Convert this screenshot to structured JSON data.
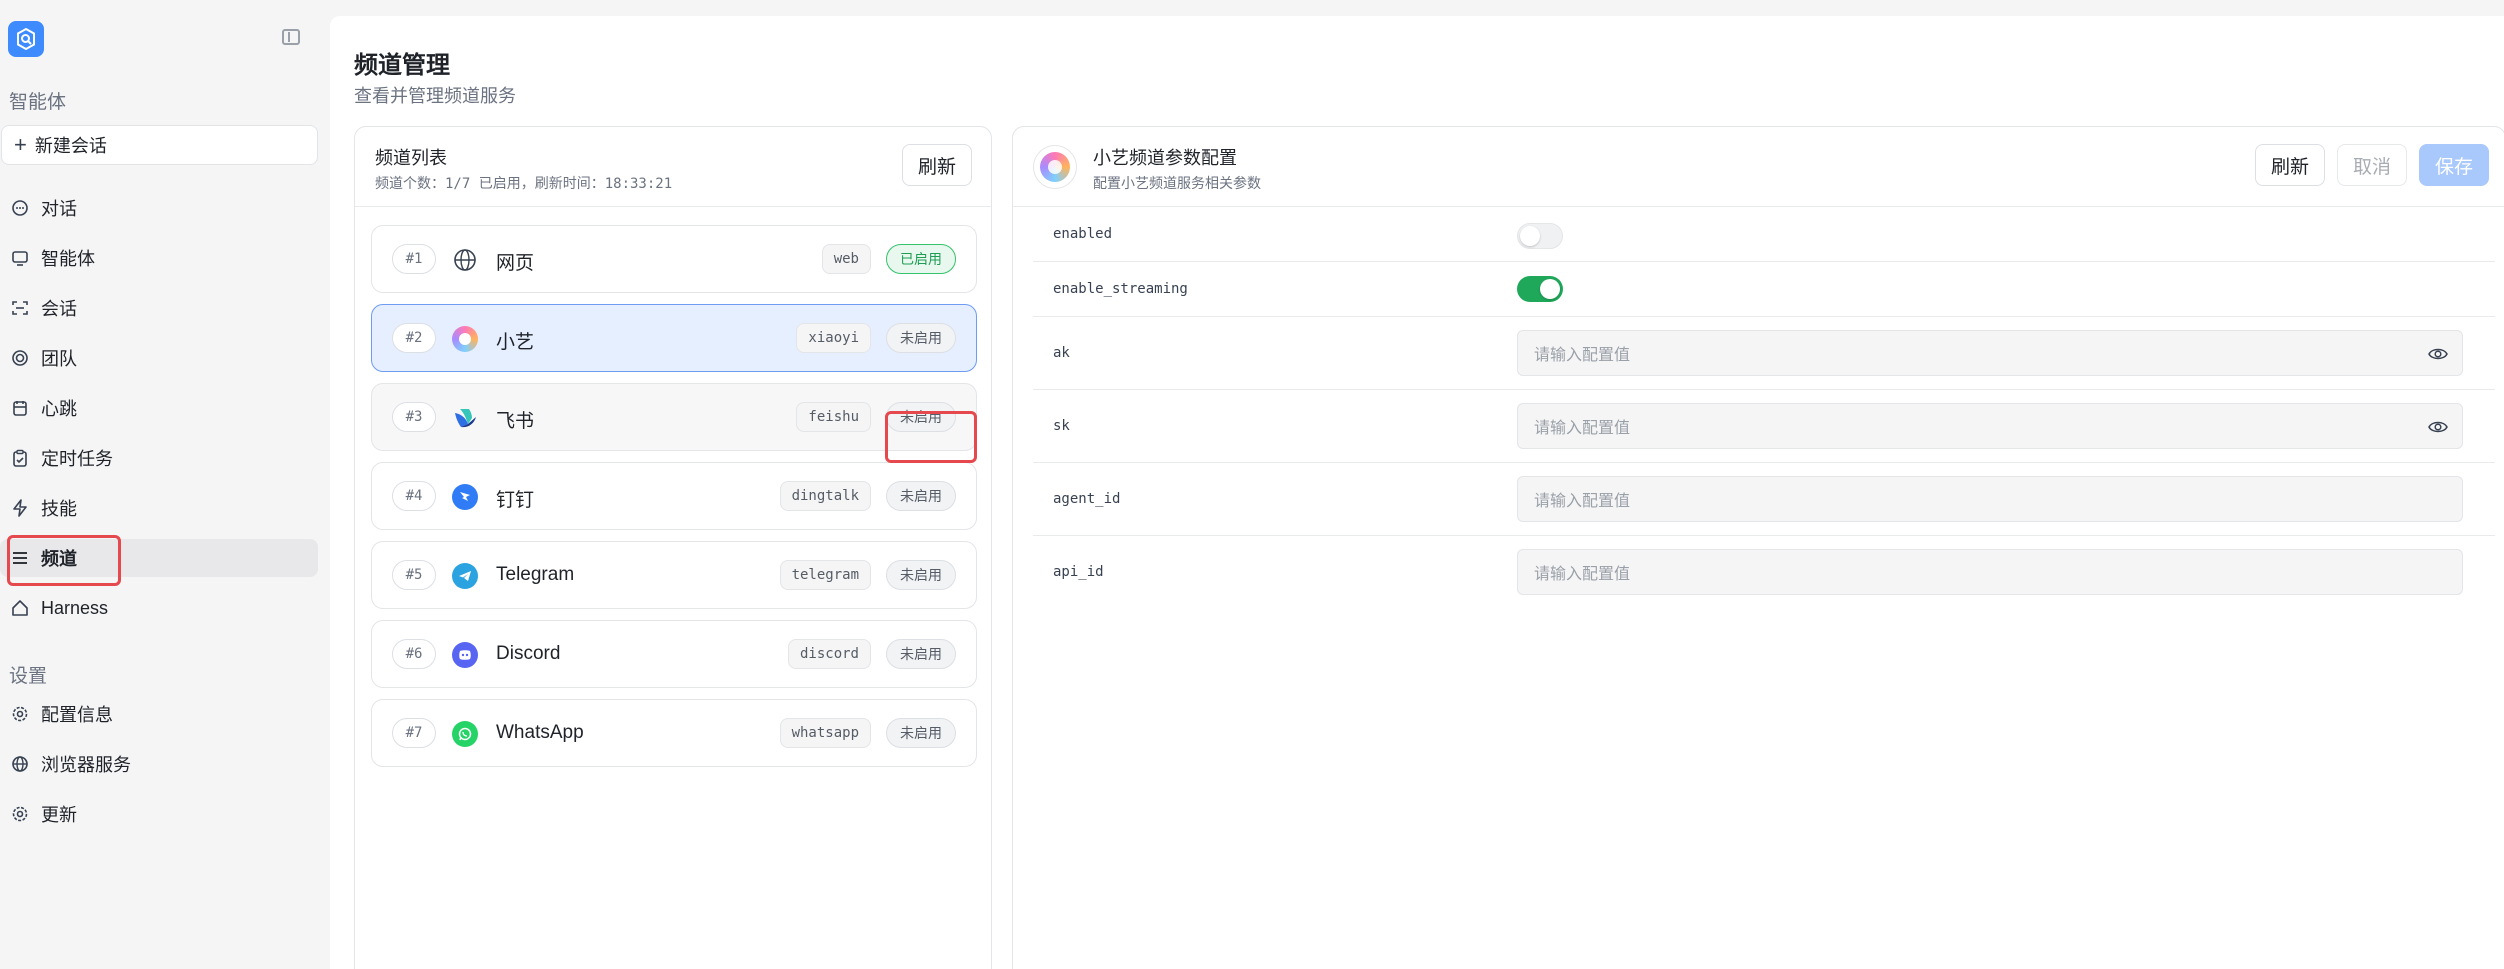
{
  "sidebar": {
    "agent_section": "智能体",
    "new_chat": "新建会话",
    "items": [
      {
        "label": "对话",
        "icon": "chat-icon"
      },
      {
        "label": "智能体",
        "icon": "monitor-icon"
      },
      {
        "label": "会话",
        "icon": "session-icon"
      },
      {
        "label": "团队",
        "icon": "team-icon"
      },
      {
        "label": "心跳",
        "icon": "heartbeat-icon"
      },
      {
        "label": "定时任务",
        "icon": "clipboard-icon"
      },
      {
        "label": "技能",
        "icon": "bolt-icon"
      },
      {
        "label": "频道",
        "icon": "list-icon",
        "active": true
      },
      {
        "label": "Harness",
        "icon": "home-icon"
      }
    ],
    "settings_section": "设置",
    "settings_items": [
      {
        "label": "配置信息",
        "icon": "gear-icon"
      },
      {
        "label": "浏览器服务",
        "icon": "globe-icon"
      },
      {
        "label": "更新",
        "icon": "gear-icon"
      }
    ]
  },
  "page": {
    "title": "频道管理",
    "subtitle": "查看并管理频道服务"
  },
  "channel_list": {
    "title": "频道列表",
    "summary": "频道个数：1/7 已启用，刷新时间：18:33:21",
    "refresh": "刷新",
    "channels": [
      {
        "num": "#1",
        "name": "网页",
        "tag": "web",
        "status": "已启用",
        "enabled": true
      },
      {
        "num": "#2",
        "name": "小艺",
        "tag": "xiaoyi",
        "status": "未启用",
        "enabled": false
      },
      {
        "num": "#3",
        "name": "飞书",
        "tag": "feishu",
        "status": "未启用",
        "enabled": false
      },
      {
        "num": "#4",
        "name": "钉钉",
        "tag": "dingtalk",
        "status": "未启用",
        "enabled": false
      },
      {
        "num": "#5",
        "name": "Telegram",
        "tag": "telegram",
        "status": "未启用",
        "enabled": false
      },
      {
        "num": "#6",
        "name": "Discord",
        "tag": "discord",
        "status": "未启用",
        "enabled": false
      },
      {
        "num": "#7",
        "name": "WhatsApp",
        "tag": "whatsapp",
        "status": "未启用",
        "enabled": false
      }
    ]
  },
  "config": {
    "title": "小艺频道参数配置",
    "subtitle": "配置小艺频道服务相关参数",
    "refresh": "刷新",
    "cancel": "取消",
    "save": "保存",
    "fields": [
      {
        "key": "enabled",
        "type": "toggle",
        "on": false
      },
      {
        "key": "enable_streaming",
        "type": "toggle",
        "on": true
      },
      {
        "key": "ak",
        "type": "secret",
        "placeholder": "请输入配置值"
      },
      {
        "key": "sk",
        "type": "secret",
        "placeholder": "请输入配置值"
      },
      {
        "key": "agent_id",
        "type": "text",
        "placeholder": "请输入配置值"
      },
      {
        "key": "api_id",
        "type": "text",
        "placeholder": "请输入配置值"
      }
    ]
  },
  "colors": {
    "accent": "#3d8bff",
    "enabled_green": "#1f9d55",
    "highlight_red": "#e5484d",
    "save_disabled": "#a9c8fb"
  }
}
